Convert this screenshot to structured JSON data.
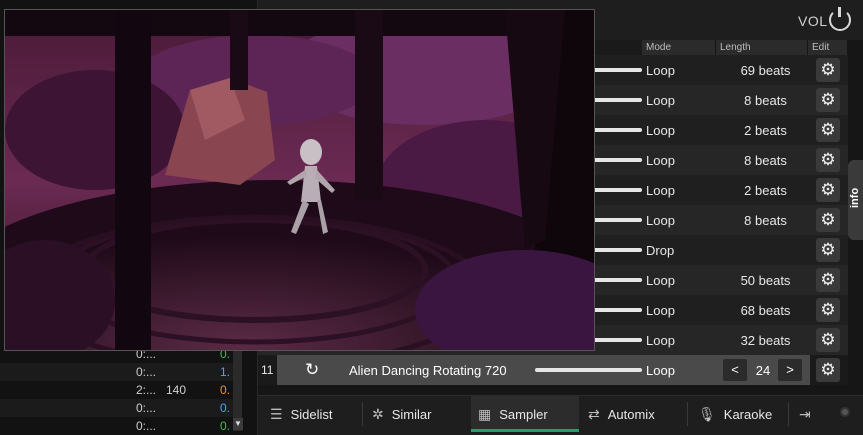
{
  "top": {
    "vol_label": "VOL"
  },
  "sampler": {
    "headers": {
      "mode": "Mode",
      "length": "Length",
      "edit": "Edit"
    },
    "rows": [
      {
        "mode": "Loop",
        "length": "69 beats"
      },
      {
        "mode": "Loop",
        "length": "8 beats"
      },
      {
        "mode": "Loop",
        "length": "2 beats"
      },
      {
        "mode": "Loop",
        "length": "8 beats"
      },
      {
        "mode": "Loop",
        "length": "2 beats"
      },
      {
        "mode": "Loop",
        "length": "8 beats"
      },
      {
        "mode": "Drop",
        "length": ""
      },
      {
        "mode": "Loop",
        "length": "50 beats"
      },
      {
        "mode": "Loop",
        "length": "68 beats"
      },
      {
        "mode": "Loop",
        "length": "32 beats"
      }
    ],
    "selected": {
      "number": "11",
      "title": "Alien Dancing Rotating 720",
      "mode": "Loop",
      "prev": "<",
      "value": "24",
      "next": ">"
    }
  },
  "info_tab": "info",
  "left_list": [
    {
      "c1": "0:...",
      "c2": "",
      "c3": "0."
    },
    {
      "c1": "0:...",
      "c2": "",
      "c3": "1."
    },
    {
      "c1": "2:...",
      "c2": "140",
      "c3": "0."
    },
    {
      "c1": "0:...",
      "c2": "",
      "c3": "0."
    },
    {
      "c1": "0:...",
      "c2": "",
      "c3": "0."
    }
  ],
  "left_list_colors": [
    "#3fbf4f",
    "#4aa3ff",
    "#ff8a2a",
    "#4aa3ff",
    "#3fbf4f"
  ],
  "bottom_tabs": [
    {
      "label": "Sidelist",
      "icon": "sidelist-icon"
    },
    {
      "label": "Similar",
      "icon": "similar-icon"
    },
    {
      "label": "Sampler",
      "icon": "sampler-grid-icon"
    },
    {
      "label": "Automix",
      "icon": "shuffle-icon"
    },
    {
      "label": "Karaoke",
      "icon": "microphone-icon"
    }
  ],
  "colors": {
    "active_tab_underline": "#1aa36b"
  }
}
